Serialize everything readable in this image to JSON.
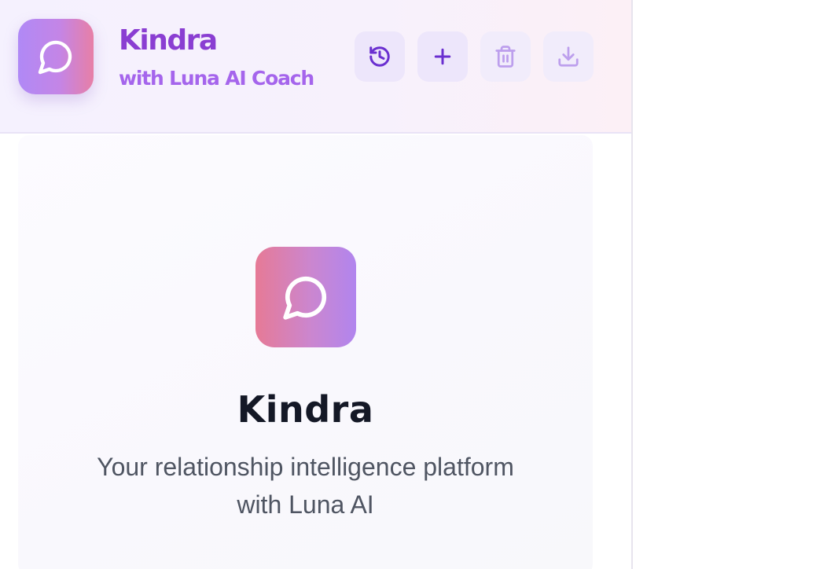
{
  "header": {
    "title": "Kindra",
    "subtitle": "with Luna AI Coach",
    "logo_icon": "chat-bubble-icon",
    "brand_colors": {
      "title": "#8a3ed2",
      "subtitle": "#a565ec"
    },
    "actions": [
      {
        "name": "history",
        "icon": "history-icon",
        "enabled": true
      },
      {
        "name": "new-chat",
        "icon": "plus-icon",
        "enabled": true
      },
      {
        "name": "delete",
        "icon": "trash-icon",
        "enabled": false
      },
      {
        "name": "export",
        "icon": "download-icon",
        "enabled": false
      }
    ]
  },
  "welcome": {
    "logo_icon": "chat-bubble-icon",
    "title": "Kindra",
    "tagline_line1": "Your relationship intelligence platform",
    "tagline_line2": "with Luna AI"
  }
}
